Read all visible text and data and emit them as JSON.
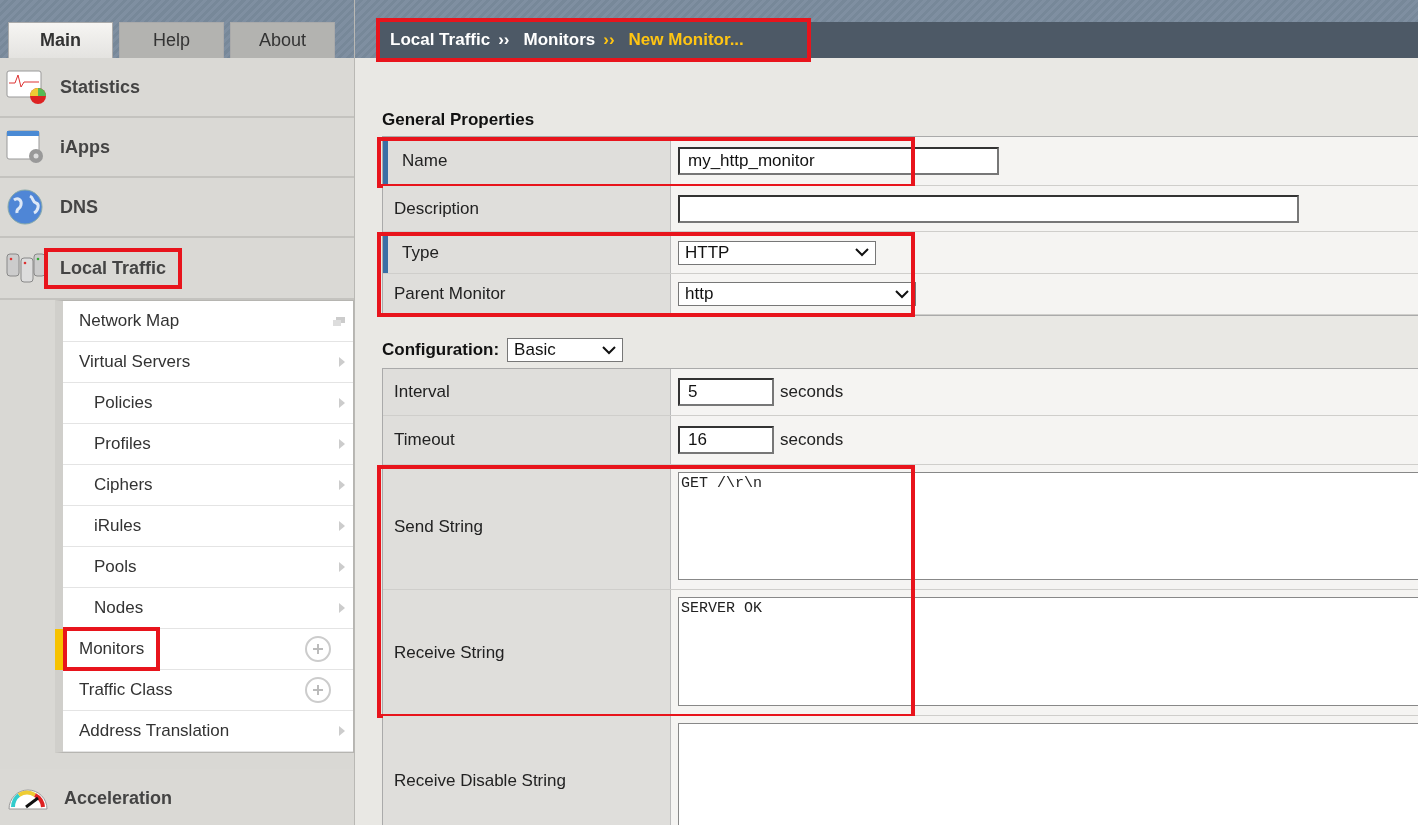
{
  "tabs": [
    {
      "label": "Main",
      "selected": true
    },
    {
      "label": "Help",
      "selected": false
    },
    {
      "label": "About",
      "selected": false
    }
  ],
  "sidebar": {
    "sections": [
      {
        "label": "Statistics",
        "highlighted": false
      },
      {
        "label": "iApps",
        "highlighted": false
      },
      {
        "label": "DNS",
        "highlighted": false
      },
      {
        "label": "Local Traffic",
        "highlighted": true,
        "items": [
          {
            "label": "Network Map",
            "kind": "popout",
            "selected": false,
            "highlighted": false
          },
          {
            "label": "Virtual Servers",
            "kind": "arrow",
            "selected": false,
            "highlighted": false,
            "children": [
              {
                "label": "Policies",
                "kind": "arrow",
                "selected": false,
                "highlighted": false
              },
              {
                "label": "Profiles",
                "kind": "arrow",
                "selected": false,
                "highlighted": false
              },
              {
                "label": "Ciphers",
                "kind": "arrow",
                "selected": false,
                "highlighted": false
              },
              {
                "label": "iRules",
                "kind": "arrow",
                "selected": false,
                "highlighted": false
              },
              {
                "label": "Pools",
                "kind": "arrow",
                "selected": false,
                "highlighted": false
              },
              {
                "label": "Nodes",
                "kind": "arrow",
                "selected": false,
                "highlighted": false
              }
            ]
          },
          {
            "label": "Monitors",
            "kind": "add",
            "selected": true,
            "highlighted": true
          },
          {
            "label": "Traffic Class",
            "kind": "add",
            "selected": false,
            "highlighted": false
          },
          {
            "label": "Address Translation",
            "kind": "arrow",
            "selected": false,
            "highlighted": false
          }
        ]
      },
      {
        "label": "Acceleration",
        "highlighted": false
      }
    ]
  },
  "breadcrumb": {
    "highlighted": true,
    "items": [
      {
        "label": "Local Traffic",
        "current": false
      },
      {
        "label": "Monitors",
        "current": false
      },
      {
        "label": "New Monitor...",
        "current": true
      }
    ],
    "separator": "››"
  },
  "general": {
    "title": "General Properties",
    "groups": [
      {
        "highlighted": true,
        "rows": [
          {
            "label": "Name",
            "required": true,
            "kind": "text",
            "value": "my_http_monitor"
          }
        ]
      },
      {
        "highlighted": false,
        "rows": [
          {
            "label": "Description",
            "required": false,
            "kind": "text",
            "value": ""
          }
        ]
      },
      {
        "highlighted": true,
        "rows": [
          {
            "label": "Type",
            "required": true,
            "kind": "select",
            "value": "HTTP"
          },
          {
            "label": "Parent Monitor",
            "required": false,
            "kind": "select",
            "value": "http"
          }
        ]
      }
    ]
  },
  "configuration": {
    "title": "Configuration:",
    "mode": "Basic",
    "groups": [
      {
        "highlighted": false,
        "rows": [
          {
            "label": "Interval",
            "required": false,
            "kind": "number",
            "value": "5",
            "unit": "seconds"
          },
          {
            "label": "Timeout",
            "required": false,
            "kind": "number",
            "value": "16",
            "unit": "seconds"
          }
        ]
      },
      {
        "highlighted": true,
        "rows": [
          {
            "label": "Send String",
            "required": false,
            "kind": "textarea",
            "value": "GET /\\r\\n"
          },
          {
            "label": "Receive String",
            "required": false,
            "kind": "textarea",
            "value": "SERVER OK"
          }
        ]
      },
      {
        "highlighted": false,
        "rows": [
          {
            "label": "Receive Disable String",
            "required": false,
            "kind": "textarea",
            "value": ""
          }
        ]
      }
    ]
  }
}
